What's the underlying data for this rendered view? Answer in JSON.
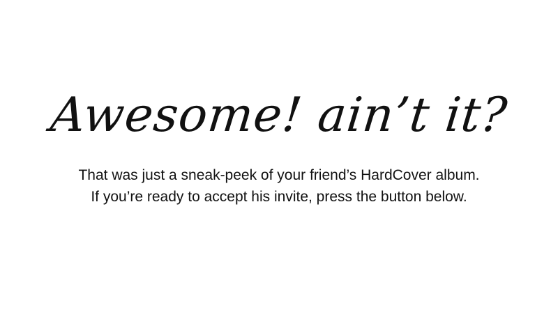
{
  "headline": "Awesome! ain’t it?",
  "message": {
    "line1": "That was just a sneak-peek of your friend’s HardCover album.",
    "line2": "If you’re ready to accept his invite, press the button below."
  },
  "colors": {
    "background": "#ffffff",
    "text": "#111111"
  }
}
